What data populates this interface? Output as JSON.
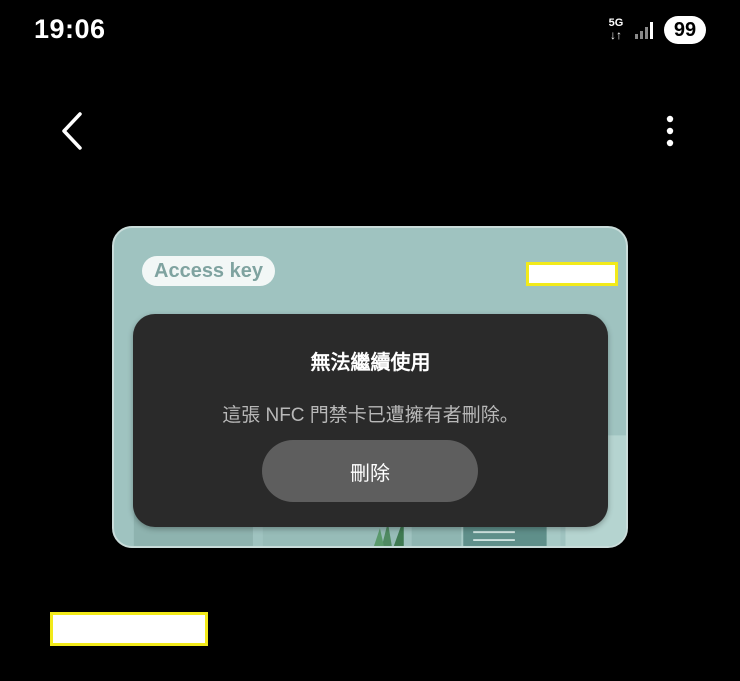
{
  "status_bar": {
    "time": "19:06",
    "network": "5G",
    "battery": "99"
  },
  "nav": {
    "back_icon": "chevron-left-icon",
    "more_icon": "more-vert-icon"
  },
  "card": {
    "badge": "Access key",
    "background_color": "#9fc3c0"
  },
  "dialog": {
    "title": "無法繼續使用",
    "message": "這張 NFC 門禁卡已遭擁有者刪除。",
    "delete_label": "刪除"
  },
  "colors": {
    "redaction_fill": "#ffffff",
    "redaction_border": "#f2ea1a",
    "dialog_bg": "#2a2a2a",
    "button_bg": "#5e5e5e"
  }
}
